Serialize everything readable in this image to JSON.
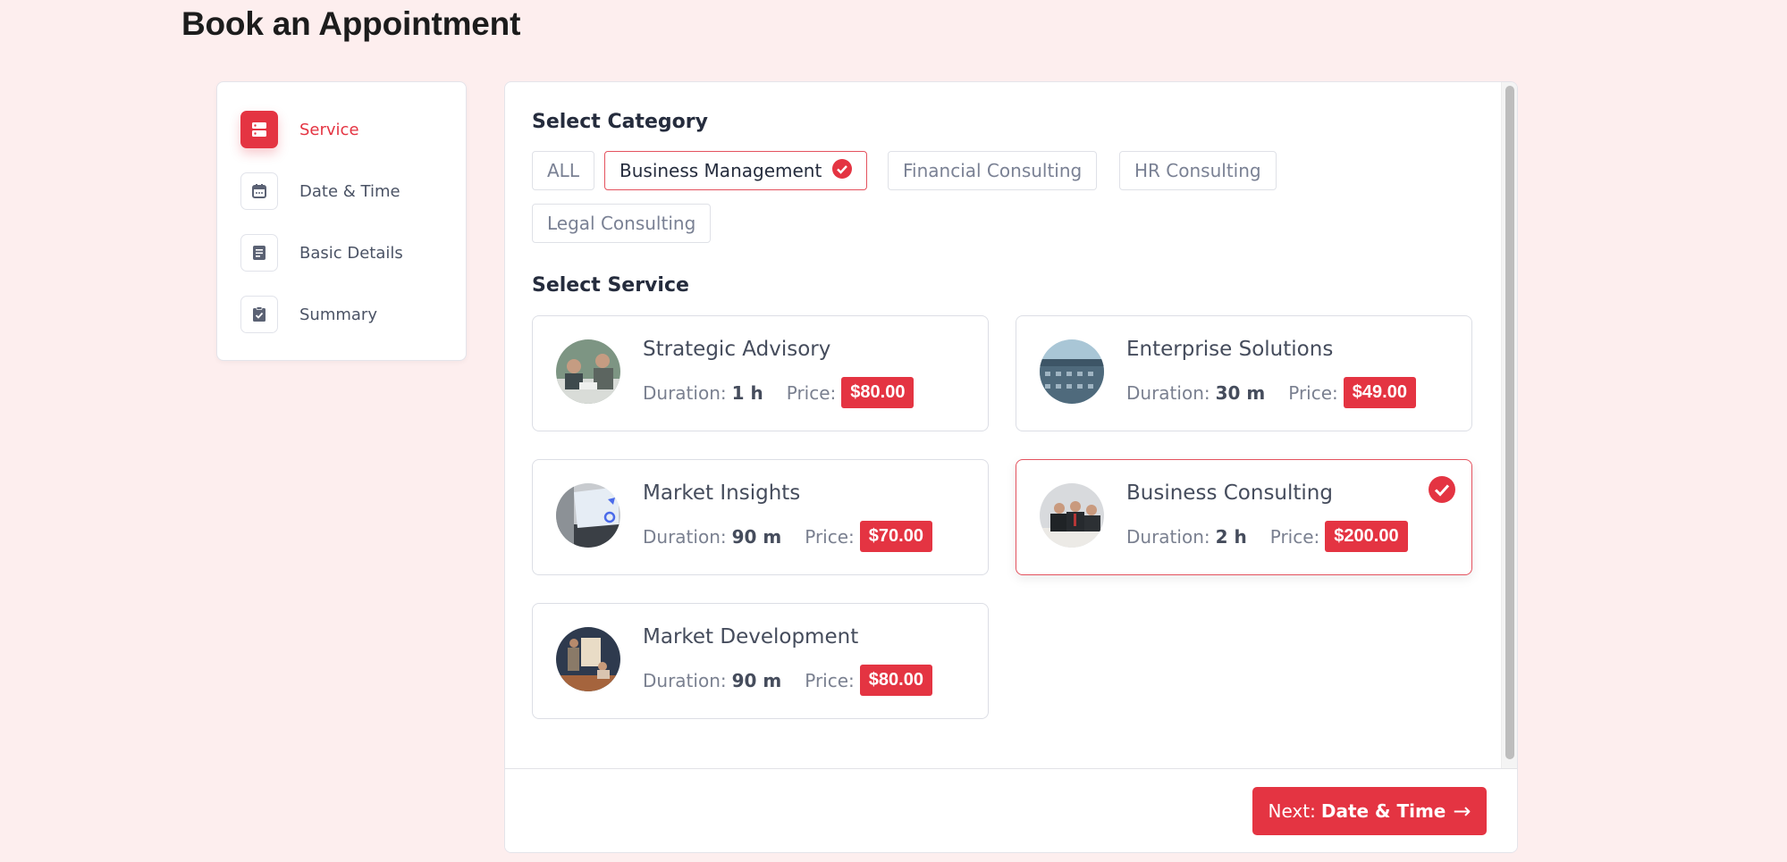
{
  "page": {
    "title": "Book an Appointment"
  },
  "steps": [
    {
      "label": "Service",
      "icon": "server-icon",
      "active": true
    },
    {
      "label": "Date & Time",
      "icon": "calendar-icon",
      "active": false
    },
    {
      "label": "Basic Details",
      "icon": "document-icon",
      "active": false
    },
    {
      "label": "Summary",
      "icon": "clipboard-check-icon",
      "active": false
    }
  ],
  "category": {
    "title": "Select Category",
    "items": [
      {
        "label": "ALL",
        "selected": false
      },
      {
        "label": "Business Management",
        "selected": true
      },
      {
        "label": "Financial Consulting",
        "selected": false
      },
      {
        "label": "HR Consulting",
        "selected": false
      },
      {
        "label": "Legal Consulting",
        "selected": false
      }
    ]
  },
  "service": {
    "title": "Select Service",
    "duration_label": "Duration:",
    "price_label": "Price:",
    "items": [
      {
        "name": "Strategic Advisory",
        "duration": "1 h",
        "price": "$80.00",
        "selected": false
      },
      {
        "name": "Enterprise Solutions",
        "duration": "30 m",
        "price": "$49.00",
        "selected": false
      },
      {
        "name": "Market Insights",
        "duration": "90 m",
        "price": "$70.00",
        "selected": false
      },
      {
        "name": "Business Consulting",
        "duration": "2 h",
        "price": "$200.00",
        "selected": true
      },
      {
        "name": "Market Development",
        "duration": "90 m",
        "price": "$80.00",
        "selected": false
      }
    ]
  },
  "footer": {
    "next_prefix": "Next:",
    "next_target": "Date & Time",
    "next_arrow": "→"
  },
  "colors": {
    "accent": "#e43442",
    "background": "#fdeeee"
  }
}
